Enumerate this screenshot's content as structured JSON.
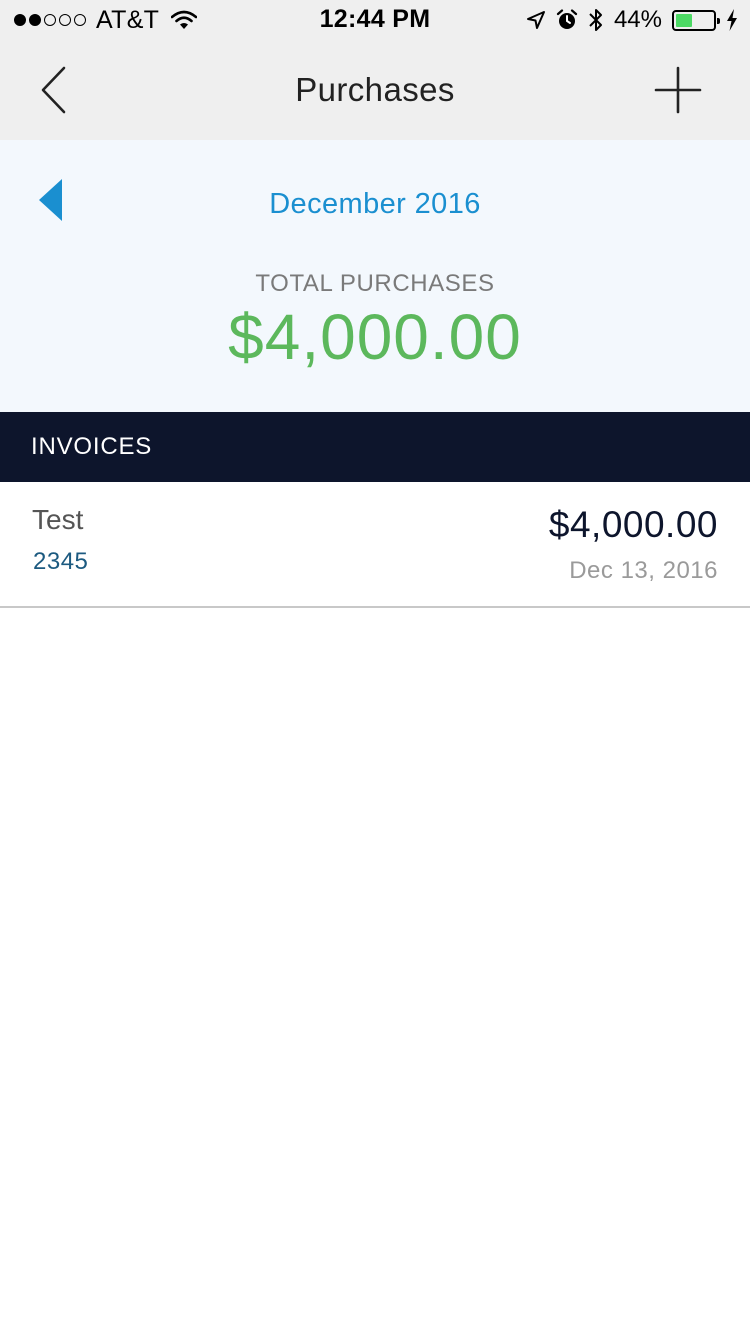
{
  "status_bar": {
    "signal_bars": 5,
    "signal_filled": 2,
    "carrier": "AT&T",
    "time": "12:44 PM",
    "battery_percent": "44%",
    "battery_level": 0.44,
    "icons": [
      "wifi-icon",
      "location-icon",
      "alarm-icon",
      "bluetooth-icon",
      "battery-icon",
      "charging-icon"
    ]
  },
  "nav": {
    "title": "Purchases",
    "back_icon": "chevron-left-icon",
    "add_icon": "plus-icon"
  },
  "summary": {
    "month": "December 2016",
    "prev_icon": "triangle-left-icon",
    "total_label": "TOTAL PURCHASES",
    "total_amount": "$4,000.00"
  },
  "invoices": {
    "header": "INVOICES",
    "items": [
      {
        "name": "Test",
        "number": "2345",
        "amount": "$4,000.00",
        "date": "Dec 13, 2016"
      }
    ]
  },
  "colors": {
    "bar_background": "#efefef",
    "summary_background": "#f3f8fd",
    "accent_blue": "#1a8fd0",
    "total_green": "#5cb85c",
    "section_header": "#0d152c",
    "battery_green": "#4cd964"
  }
}
